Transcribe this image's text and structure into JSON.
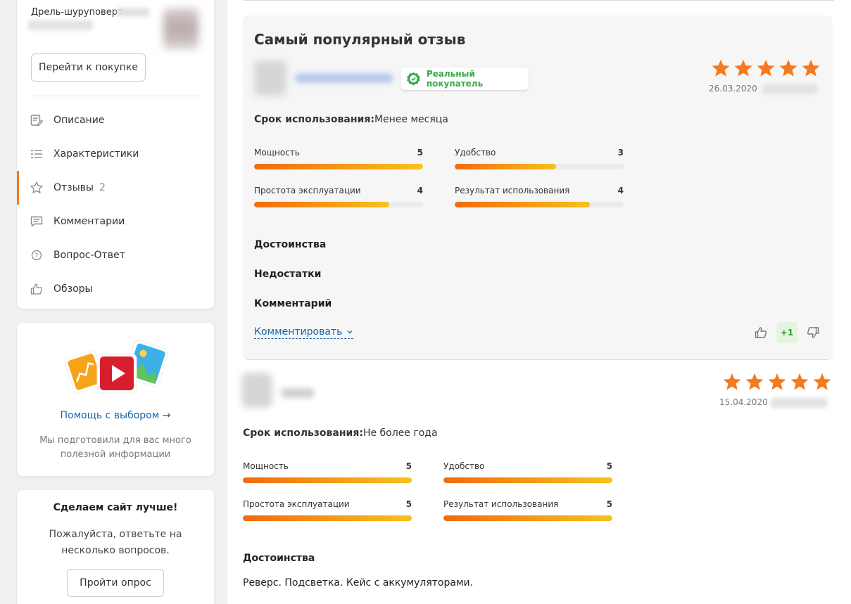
{
  "product": {
    "name": "Дрель-шуруповерт",
    "goto_label": "Перейти к покупке"
  },
  "nav": {
    "items": [
      {
        "label": "Описание",
        "icon": "edit-icon"
      },
      {
        "label": "Характеристики",
        "icon": "list-icon"
      },
      {
        "label": "Отзывы",
        "icon": "star-outline-icon",
        "count": "2",
        "active": true
      },
      {
        "label": "Комментарии",
        "icon": "comment-icon"
      },
      {
        "label": "Вопрос-Ответ",
        "icon": "question-icon"
      },
      {
        "label": "Обзоры",
        "icon": "thumb-up-icon"
      }
    ]
  },
  "help": {
    "link": "Помощь с выбором →",
    "text": "Мы подготовили для вас много полезной информации"
  },
  "survey": {
    "title": "Сделаем сайт лучше!",
    "text": "Пожалуйста, ответьте на несколько вопросов.",
    "button": "Пройти опрос"
  },
  "popular_review": {
    "title": "Самый популярный отзыв",
    "verified_label": "Реальный покупатель",
    "rating": 5,
    "date": "26.03.2020",
    "usage_label": "Срок использования:",
    "usage_value": "Менее месяца",
    "metrics": [
      {
        "label": "Мощность",
        "value": "5",
        "fraction": 1.0
      },
      {
        "label": "Удобство",
        "value": "3",
        "fraction": 0.6
      },
      {
        "label": "Простота эксплуатации",
        "value": "4",
        "fraction": 0.8
      },
      {
        "label": "Результат использования",
        "value": "4",
        "fraction": 0.8
      }
    ],
    "sections": {
      "pros": "Достоинства",
      "cons": "Недостатки",
      "comment": "Комментарий"
    },
    "comment_link": "Комментировать",
    "score": "+1"
  },
  "review2": {
    "rating": 5,
    "date": "15.04.2020",
    "usage_label": "Срок использования:",
    "usage_value": "Не более года",
    "metrics": [
      {
        "label": "Мощность",
        "value": "5",
        "fraction": 1.0
      },
      {
        "label": "Удобство",
        "value": "5",
        "fraction": 1.0
      },
      {
        "label": "Простота эксплуатации",
        "value": "5",
        "fraction": 1.0
      },
      {
        "label": "Результат использования",
        "value": "5",
        "fraction": 1.0
      }
    ],
    "pros_title": "Достоинства",
    "pros_text": "Реверс. Подсветка. Кейс с аккумуляторами."
  },
  "colors": {
    "accent": "#f47a20",
    "star": "#f47a20",
    "link": "#1a64a8",
    "verified": "#39a94b"
  }
}
